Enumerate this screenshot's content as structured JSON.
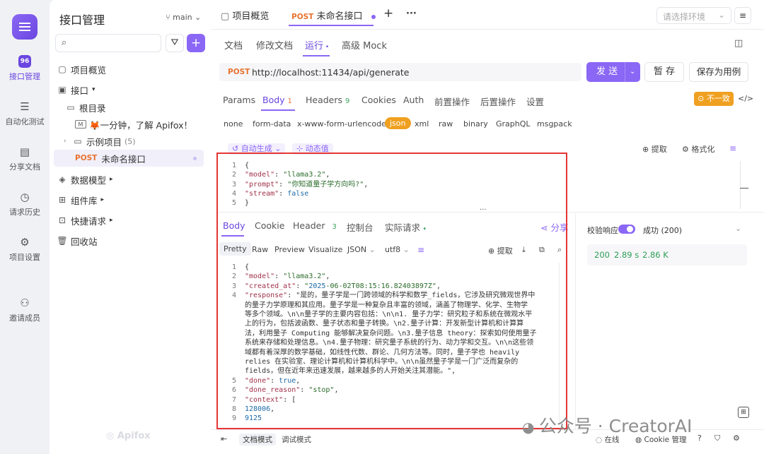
{
  "rail": {
    "items": [
      {
        "label": "接口管理",
        "icon": "api-icon"
      },
      {
        "label": "自动化测试",
        "icon": "stack-icon"
      },
      {
        "label": "分享文档",
        "icon": "book-icon"
      },
      {
        "label": "请求历史",
        "icon": "clock-icon"
      },
      {
        "label": "项目设置",
        "icon": "gear-icon"
      },
      {
        "label": "邀请成员",
        "icon": "user-plus-icon"
      }
    ]
  },
  "sidebar": {
    "title": "接口管理",
    "branch": "main",
    "tree": {
      "overview": "项目概览",
      "api": "接口",
      "root": "根目录",
      "intro": "🦊一分钟，了解 Apifox！",
      "examples": "示例项目",
      "examples_count": "(5)",
      "post_method": "POST",
      "post_name": "未命名接口",
      "models": "数据模型",
      "components": "组件库",
      "quick": "快捷请求",
      "trash": "回收站"
    },
    "footer_logo": "Apifox"
  },
  "topbar": {
    "overview_tab": "项目概览",
    "active_method": "POST",
    "active_tab": "未命名接口",
    "plus": "+",
    "more": "···",
    "env_placeholder": "请选择环境"
  },
  "subtabs": {
    "doc": "文档",
    "edit": "修改文档",
    "run": "运行",
    "mock": "高级 Mock"
  },
  "request": {
    "method": "POST",
    "url": "http://localhost:11434/api/generate",
    "send": "发 送",
    "save": "暂 存",
    "save_case": "保存为用例"
  },
  "params_tabs": {
    "params": "Params",
    "body": "Body",
    "body_count": "1",
    "headers": "Headers",
    "headers_count": "9",
    "cookies": "Cookies",
    "auth": "Auth",
    "pre": "前置操作",
    "post": "后置操作",
    "settings": "设置",
    "mismatch": "不一致"
  },
  "body_types": [
    "none",
    "form-data",
    "x-www-form-urlencoded",
    "json",
    "xml",
    "raw",
    "binary",
    "GraphQL",
    "msgpack"
  ],
  "body_tools": {
    "auto": "自动生成",
    "dynamic": "动态值",
    "extract": "提取",
    "format": "格式化"
  },
  "request_body": [
    {
      "n": "1",
      "t": "{"
    },
    {
      "n": "2",
      "t": "  \"model\": \"llama3.2\","
    },
    {
      "n": "3",
      "t": "  \"prompt\": \"你知道量子学方向吗?\","
    },
    {
      "n": "4",
      "t": "  \"stream\":  false"
    },
    {
      "n": "5",
      "t": "}"
    }
  ],
  "response_tabs": {
    "body": "Body",
    "cookie": "Cookie",
    "header": "Header",
    "header_count": "3",
    "console": "控制台",
    "actual": "实际请求",
    "share": "分享"
  },
  "view_tabs": {
    "pretty": "Pretty",
    "raw": "Raw",
    "preview": "Preview",
    "visualize": "Visualize",
    "format": "JSON",
    "encoding": "utf8",
    "extract": "提取"
  },
  "response_body": [
    {
      "n": "1",
      "t": "{"
    },
    {
      "n": "2",
      "t": "    \"model\": \"llama3.2\","
    },
    {
      "n": "3",
      "t": "    \"created_at\": \"2025-06-02T08:15:16.82403897Z\","
    },
    {
      "n": "4",
      "t": "    \"response\": \"是的，量子学是一门跨领域的科学和数学_fields，它涉及研究微观世界中"
    },
    {
      "n": "",
      "t": "    的量子力学原理和其应用。量子学是一种复杂且丰富的领域，涵盖了物理学、化学、生物学"
    },
    {
      "n": "",
      "t": "    等多个领域。\\n\\n量子学的主要内容包括：\\n\\n1. 量子力学：研究粒子和系统在微观水平"
    },
    {
      "n": "",
      "t": "    上的行为，包括波函数、量子状态和量子转换。\\n2.量子计算：开发新型计算机和计算算"
    },
    {
      "n": "",
      "t": "    法，利用量子 Computing 能够解决复杂问题。\\n3.量子信息 theory：探索如何使用量子"
    },
    {
      "n": "",
      "t": "    系统来存储和处理信息。\\n4.量子物理：研究量子系统的行为、动力学和交互。\\n\\n这些领"
    },
    {
      "n": "",
      "t": "    域都有着深厚的数学基础，如线性代数、群论、几何方法等。同时，量子学也 heavily"
    },
    {
      "n": "",
      "t": "    relies 在实验室、理论计算机和计算机科学中。\\n\\n虽然量子学是一门广泛而复杂的"
    },
    {
      "n": "",
      "t": "    fields，但在近年来迅速发展，越来越多的人开始关注其潜能。\","
    },
    {
      "n": "5",
      "t": "    \"done\": true,"
    },
    {
      "n": "6",
      "t": "    \"done_reason\": \"stop\","
    },
    {
      "n": "7",
      "t": "    \"context\": ["
    },
    {
      "n": "8",
      "t": "        128006,"
    },
    {
      "n": "9",
      "t": "        9125"
    }
  ],
  "right_panel": {
    "verify": "校验响应",
    "status_label": "成功 (200)",
    "code": "200",
    "time": "2.89 s",
    "size": "2.86 K"
  },
  "bottom": {
    "doc_mode": "文档模式",
    "debug_mode": "调试模式",
    "online": "在线",
    "cookie": "Cookie 管理"
  },
  "watermark": "公众号 · CreatorAI"
}
